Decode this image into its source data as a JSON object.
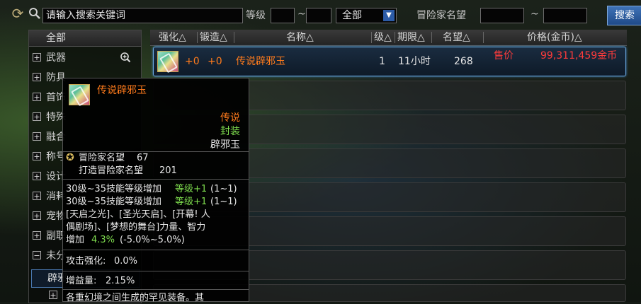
{
  "search": {
    "placeholder": "请输入搜索关键词",
    "level_label": "等级",
    "level_min": "",
    "level_max": "",
    "tilde": "~",
    "category_selected": "全部",
    "fame_label": "冒险家名望",
    "fame_min": "",
    "fame_max": "",
    "button_label": "搜索"
  },
  "category_panel": {
    "header": "全部",
    "items": [
      {
        "toggle": "+",
        "label": "武器"
      },
      {
        "toggle": "+",
        "label": "防具"
      },
      {
        "toggle": "+",
        "label": "首饰"
      },
      {
        "toggle": "+",
        "label": "特殊"
      },
      {
        "toggle": "+",
        "label": "融合"
      },
      {
        "toggle": "+",
        "label": "称号"
      },
      {
        "toggle": "+",
        "label": "设计"
      },
      {
        "toggle": "+",
        "label": "消耗"
      },
      {
        "toggle": "+",
        "label": "宠物"
      },
      {
        "toggle": "+",
        "label": "副职"
      },
      {
        "toggle": "−",
        "label": "未分"
      }
    ],
    "selected_sub": "辟邪",
    "next_toggle": "+"
  },
  "table": {
    "columns": [
      "强化△",
      "锻造△",
      "名称△",
      "级△",
      "期限△",
      "名望△",
      "价格(金币)△"
    ],
    "rows": [
      {
        "enhance": "+0",
        "forge": "+0",
        "name": "传说辟邪玉",
        "level": "1",
        "duration": "11小时",
        "fame": "268",
        "price_label": "售价",
        "price": "99,311,459金币"
      }
    ]
  },
  "tooltip": {
    "name": "传说辟邪玉",
    "rarity": "传说",
    "state": "封装",
    "type": "辟邪玉",
    "fame_label": "冒险家名望",
    "fame_value": "67",
    "forge_fame_label": "打造冒险家名望",
    "forge_fame_value": "201",
    "skill_line1": "30级~35技能等级增加",
    "skill_line1_bonus": "等级+1",
    "skill_line1_range": "(1~1)",
    "skill_line2": "30级~35技能等级增加",
    "skill_line2_bonus": "等级+1",
    "skill_line2_range": "(1~1)",
    "desc_line1": "[天启之光]、[圣光天启]、[开幕! 人",
    "desc_line2": "偶剧场]、[梦想的舞台]力量、智力",
    "desc_line3_prefix": "增加",
    "desc_line3_value": "4.3%",
    "desc_line3_range": "(-5.0%~5.0%)",
    "attack_label": "攻击强化:",
    "attack_value": "0.0%",
    "gain_label": "增益量:",
    "gain_value": "2.15%",
    "footer": "各重幻境之间生成的罕见装备。其"
  },
  "colors": {
    "legendary": "#ff7b1c",
    "green": "#7edc4e",
    "price_red": "#ff3b3b",
    "select_blue": "#6aa8e0"
  }
}
